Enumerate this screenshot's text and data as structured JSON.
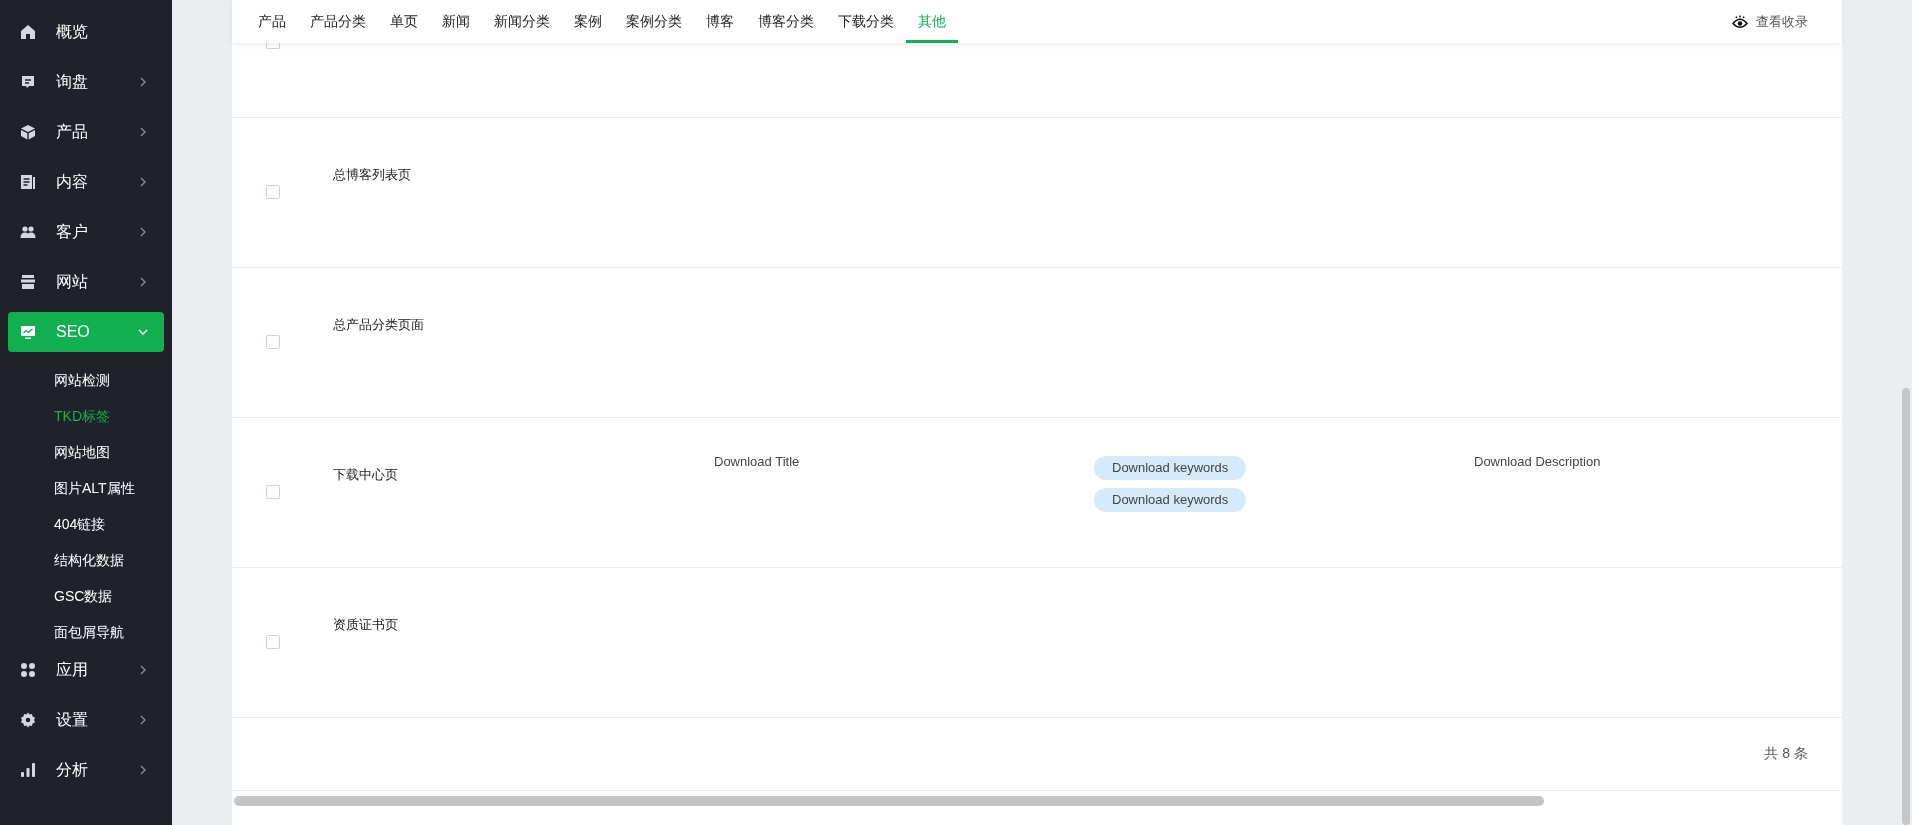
{
  "sidebar": {
    "items": [
      {
        "label": "概览",
        "kind": "link",
        "selected": false
      },
      {
        "label": "询盘",
        "kind": "menu",
        "expanded": false,
        "selected": false
      },
      {
        "label": "产品",
        "kind": "menu",
        "expanded": false,
        "selected": false
      },
      {
        "label": "内容",
        "kind": "menu",
        "expanded": false,
        "selected": false
      },
      {
        "label": "客户",
        "kind": "menu",
        "expanded": false,
        "selected": false
      },
      {
        "label": "网站",
        "kind": "menu",
        "expanded": false,
        "selected": false
      },
      {
        "label": "SEO",
        "kind": "menu",
        "expanded": true,
        "selected": true,
        "children": [
          {
            "label": "网站检测",
            "selected": false
          },
          {
            "label": "TKD标签",
            "selected": true
          },
          {
            "label": "网站地图",
            "selected": false
          },
          {
            "label": "图片ALT属性",
            "selected": false
          },
          {
            "label": "404链接",
            "selected": false
          },
          {
            "label": "结构化数据",
            "selected": false
          },
          {
            "label": "GSC数据",
            "selected": false
          },
          {
            "label": "面包屑导航",
            "selected": false
          }
        ]
      },
      {
        "label": "应用",
        "kind": "menu",
        "expanded": false,
        "selected": false
      },
      {
        "label": "设置",
        "kind": "menu",
        "expanded": false,
        "selected": false
      },
      {
        "label": "分析",
        "kind": "menu",
        "expanded": false,
        "selected": false
      }
    ]
  },
  "tabs": [
    {
      "label": "产品",
      "selected": false
    },
    {
      "label": "产品分类",
      "selected": false
    },
    {
      "label": "单页",
      "selected": false
    },
    {
      "label": "新闻",
      "selected": false
    },
    {
      "label": "新闻分类",
      "selected": false
    },
    {
      "label": "案例",
      "selected": false
    },
    {
      "label": "案例分类",
      "selected": false
    },
    {
      "label": "博客",
      "selected": false
    },
    {
      "label": "博客分类",
      "selected": false
    },
    {
      "label": "下载分类",
      "selected": false
    },
    {
      "label": "其他",
      "selected": true
    }
  ],
  "view_index_link": "查看收录",
  "table": {
    "rows": [
      {
        "checked": false
      },
      {
        "checked": false,
        "name": "总博客列表页"
      },
      {
        "checked": false,
        "name": "总产品分类页面"
      },
      {
        "checked": false,
        "name": "下载中心页",
        "title": "Download Title",
        "keywords": [
          "Download keywords",
          "Download keywords"
        ],
        "description": "Download Description"
      },
      {
        "checked": false,
        "name": "资质证书页"
      }
    ]
  },
  "total": "共 8 条"
}
